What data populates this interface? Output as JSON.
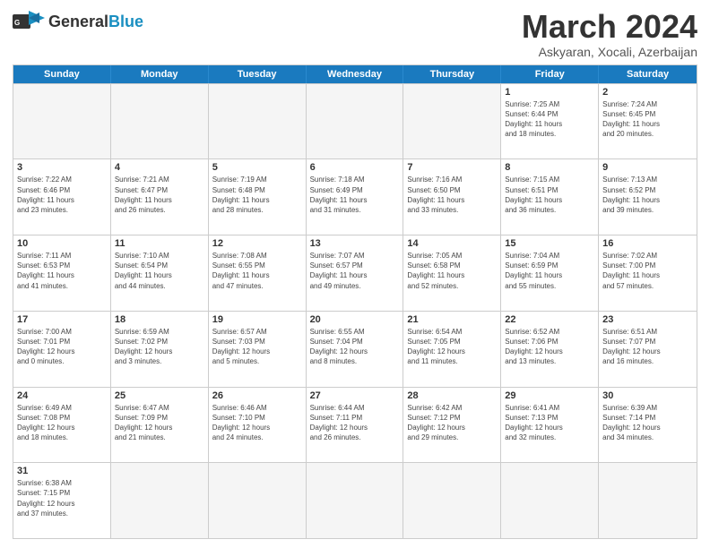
{
  "header": {
    "logo_general": "General",
    "logo_blue": "Blue",
    "month_title": "March 2024",
    "subtitle": "Askyaran, Xocali, Azerbaijan"
  },
  "weekdays": [
    "Sunday",
    "Monday",
    "Tuesday",
    "Wednesday",
    "Thursday",
    "Friday",
    "Saturday"
  ],
  "rows": [
    [
      {
        "day": "",
        "info": ""
      },
      {
        "day": "",
        "info": ""
      },
      {
        "day": "",
        "info": ""
      },
      {
        "day": "",
        "info": ""
      },
      {
        "day": "",
        "info": ""
      },
      {
        "day": "1",
        "info": "Sunrise: 7:25 AM\nSunset: 6:44 PM\nDaylight: 11 hours\nand 18 minutes."
      },
      {
        "day": "2",
        "info": "Sunrise: 7:24 AM\nSunset: 6:45 PM\nDaylight: 11 hours\nand 20 minutes."
      }
    ],
    [
      {
        "day": "3",
        "info": "Sunrise: 7:22 AM\nSunset: 6:46 PM\nDaylight: 11 hours\nand 23 minutes."
      },
      {
        "day": "4",
        "info": "Sunrise: 7:21 AM\nSunset: 6:47 PM\nDaylight: 11 hours\nand 26 minutes."
      },
      {
        "day": "5",
        "info": "Sunrise: 7:19 AM\nSunset: 6:48 PM\nDaylight: 11 hours\nand 28 minutes."
      },
      {
        "day": "6",
        "info": "Sunrise: 7:18 AM\nSunset: 6:49 PM\nDaylight: 11 hours\nand 31 minutes."
      },
      {
        "day": "7",
        "info": "Sunrise: 7:16 AM\nSunset: 6:50 PM\nDaylight: 11 hours\nand 33 minutes."
      },
      {
        "day": "8",
        "info": "Sunrise: 7:15 AM\nSunset: 6:51 PM\nDaylight: 11 hours\nand 36 minutes."
      },
      {
        "day": "9",
        "info": "Sunrise: 7:13 AM\nSunset: 6:52 PM\nDaylight: 11 hours\nand 39 minutes."
      }
    ],
    [
      {
        "day": "10",
        "info": "Sunrise: 7:11 AM\nSunset: 6:53 PM\nDaylight: 11 hours\nand 41 minutes."
      },
      {
        "day": "11",
        "info": "Sunrise: 7:10 AM\nSunset: 6:54 PM\nDaylight: 11 hours\nand 44 minutes."
      },
      {
        "day": "12",
        "info": "Sunrise: 7:08 AM\nSunset: 6:55 PM\nDaylight: 11 hours\nand 47 minutes."
      },
      {
        "day": "13",
        "info": "Sunrise: 7:07 AM\nSunset: 6:57 PM\nDaylight: 11 hours\nand 49 minutes."
      },
      {
        "day": "14",
        "info": "Sunrise: 7:05 AM\nSunset: 6:58 PM\nDaylight: 11 hours\nand 52 minutes."
      },
      {
        "day": "15",
        "info": "Sunrise: 7:04 AM\nSunset: 6:59 PM\nDaylight: 11 hours\nand 55 minutes."
      },
      {
        "day": "16",
        "info": "Sunrise: 7:02 AM\nSunset: 7:00 PM\nDaylight: 11 hours\nand 57 minutes."
      }
    ],
    [
      {
        "day": "17",
        "info": "Sunrise: 7:00 AM\nSunset: 7:01 PM\nDaylight: 12 hours\nand 0 minutes."
      },
      {
        "day": "18",
        "info": "Sunrise: 6:59 AM\nSunset: 7:02 PM\nDaylight: 12 hours\nand 3 minutes."
      },
      {
        "day": "19",
        "info": "Sunrise: 6:57 AM\nSunset: 7:03 PM\nDaylight: 12 hours\nand 5 minutes."
      },
      {
        "day": "20",
        "info": "Sunrise: 6:55 AM\nSunset: 7:04 PM\nDaylight: 12 hours\nand 8 minutes."
      },
      {
        "day": "21",
        "info": "Sunrise: 6:54 AM\nSunset: 7:05 PM\nDaylight: 12 hours\nand 11 minutes."
      },
      {
        "day": "22",
        "info": "Sunrise: 6:52 AM\nSunset: 7:06 PM\nDaylight: 12 hours\nand 13 minutes."
      },
      {
        "day": "23",
        "info": "Sunrise: 6:51 AM\nSunset: 7:07 PM\nDaylight: 12 hours\nand 16 minutes."
      }
    ],
    [
      {
        "day": "24",
        "info": "Sunrise: 6:49 AM\nSunset: 7:08 PM\nDaylight: 12 hours\nand 18 minutes."
      },
      {
        "day": "25",
        "info": "Sunrise: 6:47 AM\nSunset: 7:09 PM\nDaylight: 12 hours\nand 21 minutes."
      },
      {
        "day": "26",
        "info": "Sunrise: 6:46 AM\nSunset: 7:10 PM\nDaylight: 12 hours\nand 24 minutes."
      },
      {
        "day": "27",
        "info": "Sunrise: 6:44 AM\nSunset: 7:11 PM\nDaylight: 12 hours\nand 26 minutes."
      },
      {
        "day": "28",
        "info": "Sunrise: 6:42 AM\nSunset: 7:12 PM\nDaylight: 12 hours\nand 29 minutes."
      },
      {
        "day": "29",
        "info": "Sunrise: 6:41 AM\nSunset: 7:13 PM\nDaylight: 12 hours\nand 32 minutes."
      },
      {
        "day": "30",
        "info": "Sunrise: 6:39 AM\nSunset: 7:14 PM\nDaylight: 12 hours\nand 34 minutes."
      }
    ],
    [
      {
        "day": "31",
        "info": "Sunrise: 6:38 AM\nSunset: 7:15 PM\nDaylight: 12 hours\nand 37 minutes."
      },
      {
        "day": "",
        "info": ""
      },
      {
        "day": "",
        "info": ""
      },
      {
        "day": "",
        "info": ""
      },
      {
        "day": "",
        "info": ""
      },
      {
        "day": "",
        "info": ""
      },
      {
        "day": "",
        "info": ""
      }
    ]
  ]
}
